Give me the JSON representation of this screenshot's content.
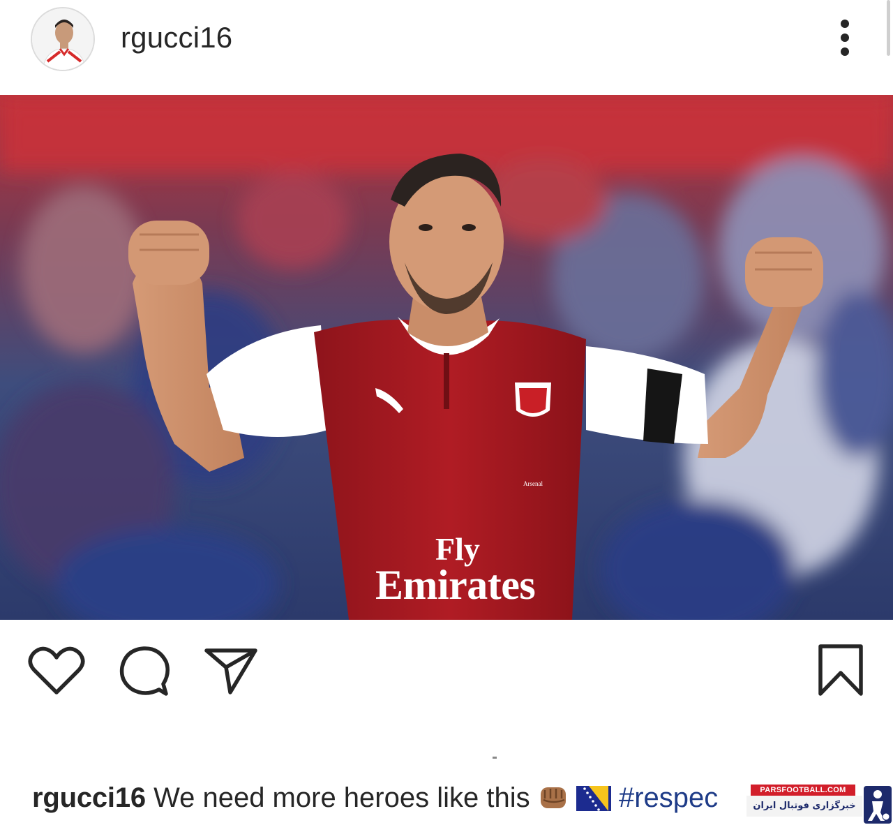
{
  "post": {
    "username": "rgucci16",
    "avatar_icon": "profile-avatar",
    "more_icon": "more-vertical-icon"
  },
  "photo": {
    "jersey_brand": "Fly",
    "jersey_sponsor": "Emirates",
    "badge_text": "Arsenal"
  },
  "actions": {
    "like_icon": "heart-icon",
    "comment_icon": "comment-icon",
    "share_icon": "paper-plane-icon",
    "save_icon": "bookmark-icon"
  },
  "caption": {
    "username": "rgucci16",
    "text": "We need more heroes like this",
    "hashtag": "#respec"
  },
  "watermark": {
    "site": "PARSFOOTBALL.COM",
    "tagline": "خبرگزاری فوتبال ایران"
  },
  "colors": {
    "text": "#262626",
    "hashtag": "#1f3c88",
    "jersey_red": "#a6171f",
    "watermark_red": "#d21e2a"
  }
}
